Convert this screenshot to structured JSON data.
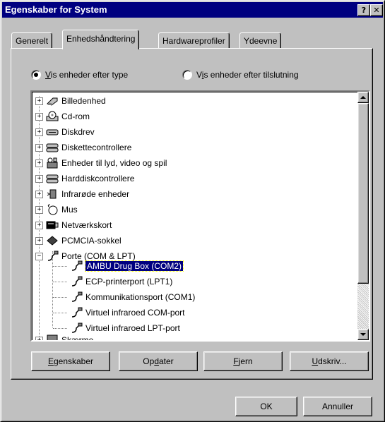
{
  "window": {
    "title": "Egenskaber for System",
    "help_label": "?",
    "close_label": "✕"
  },
  "tabs": [
    {
      "label": "Generelt"
    },
    {
      "label": "Enhedshåndtering"
    },
    {
      "label": "Hardwareprofiler"
    },
    {
      "label": "Ydeevne"
    }
  ],
  "view_options": {
    "by_type": {
      "pre": "",
      "accel": "V",
      "post": "is enheder efter type",
      "selected": true
    },
    "by_connection": {
      "pre": "V",
      "accel": "i",
      "post": "s enheder efter tilslutning",
      "selected": false
    }
  },
  "device_tree": {
    "categories": [
      {
        "label": "Billedenhed",
        "icon": "camera-icon",
        "expander": "+"
      },
      {
        "label": "Cd-rom",
        "icon": "cdrom-icon",
        "expander": "+"
      },
      {
        "label": "Diskdrev",
        "icon": "disk-drive-icon",
        "expander": "+"
      },
      {
        "label": "Diskettecontrollere",
        "icon": "disk-controller-icon",
        "expander": "+"
      },
      {
        "label": "Enheder til lyd, video og spil",
        "icon": "sound-video-icon",
        "expander": "+"
      },
      {
        "label": "Harddiskcontrollere",
        "icon": "disk-controller-icon",
        "expander": "+"
      },
      {
        "label": "Infrarøde enheder",
        "icon": "infrared-icon",
        "expander": "+"
      },
      {
        "label": "Mus",
        "icon": "mouse-icon",
        "expander": "+"
      },
      {
        "label": "Netværkskort",
        "icon": "network-card-icon",
        "expander": "+"
      },
      {
        "label": "PCMCIA-sokkel",
        "icon": "pcmcia-icon",
        "expander": "+"
      },
      {
        "label": "Porte (COM & LPT)",
        "icon": "port-connector-icon",
        "expander": "−"
      }
    ],
    "port_children": [
      {
        "label": "AMBU Drug Box (COM2)",
        "selected": true
      },
      {
        "label": "ECP-printerport (LPT1)",
        "selected": false
      },
      {
        "label": "Kommunikationsport (COM1)",
        "selected": false
      },
      {
        "label": "Virtuel infraroed COM-port",
        "selected": false
      },
      {
        "label": "Virtuel infraroed LPT-port",
        "selected": false
      }
    ],
    "partial_next": {
      "label": "Skærme",
      "expander": "+"
    }
  },
  "buttons": {
    "properties": {
      "pre": "",
      "accel": "E",
      "post": "genskaber"
    },
    "refresh": {
      "pre": "Op",
      "accel": "d",
      "post": "ater"
    },
    "remove": {
      "pre": "",
      "accel": "F",
      "post": "jern"
    },
    "print": {
      "pre": "",
      "accel": "U",
      "post": "dskriv..."
    },
    "ok": "OK",
    "cancel": "Annuller"
  },
  "colors": {
    "face": "#c0c0c0",
    "titlebar": "#000080",
    "selection": "#000080"
  }
}
